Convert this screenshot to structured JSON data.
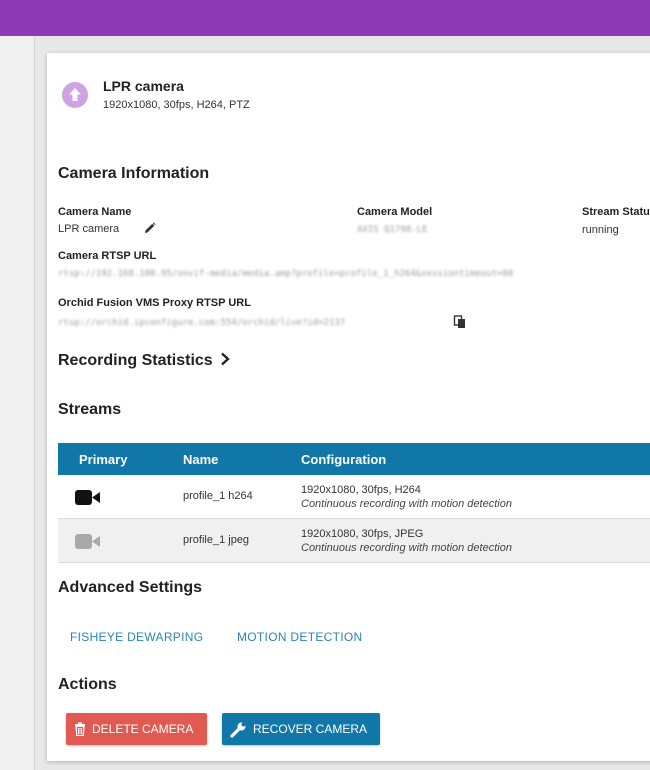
{
  "camera": {
    "title": "LPR camera",
    "subtitle": "1920x1080, 30fps, H264, PTZ"
  },
  "info": {
    "heading": "Camera Information",
    "name_label": "Camera Name",
    "name_value": "LPR camera",
    "model_label": "Camera Model",
    "model_value": "AXIS Q1798-LE",
    "status_label": "Stream Status",
    "status_value": "running",
    "rtsp_label": "Camera RTSP URL",
    "rtsp_value": "rtsp://192.168.100.95/onvif-media/media.amp?profile=profile_1_h264&sessiontimeout=60",
    "proxy_label": "Orchid Fusion VMS Proxy RTSP URL",
    "proxy_value": "rtsp://orchid.ipconfigure.com:554/orchid/live?id=2137"
  },
  "recording": {
    "heading": "Recording Statistics"
  },
  "streams": {
    "heading": "Streams",
    "columns": [
      "Primary",
      "Name",
      "Configuration"
    ],
    "rows": [
      {
        "primary": true,
        "name": "profile_1 h264",
        "config": "1920x1080, 30fps, H264",
        "mode": "Continuous recording with motion detection"
      },
      {
        "primary": false,
        "name": "profile_1 jpeg",
        "config": "1920x1080, 30fps, JPEG",
        "mode": "Continuous recording with motion detection"
      }
    ]
  },
  "advanced": {
    "heading": "Advanced Settings",
    "fisheye": "FISHEYE DEWARPING",
    "motion": "MOTION DETECTION"
  },
  "actions": {
    "heading": "Actions",
    "delete": "DELETE CAMERA",
    "recover": "RECOVER CAMERA"
  },
  "colors": {
    "header": "#8e3ab5",
    "accent": "#1177a8",
    "danger": "#e05a51",
    "link": "#2a86b5"
  }
}
